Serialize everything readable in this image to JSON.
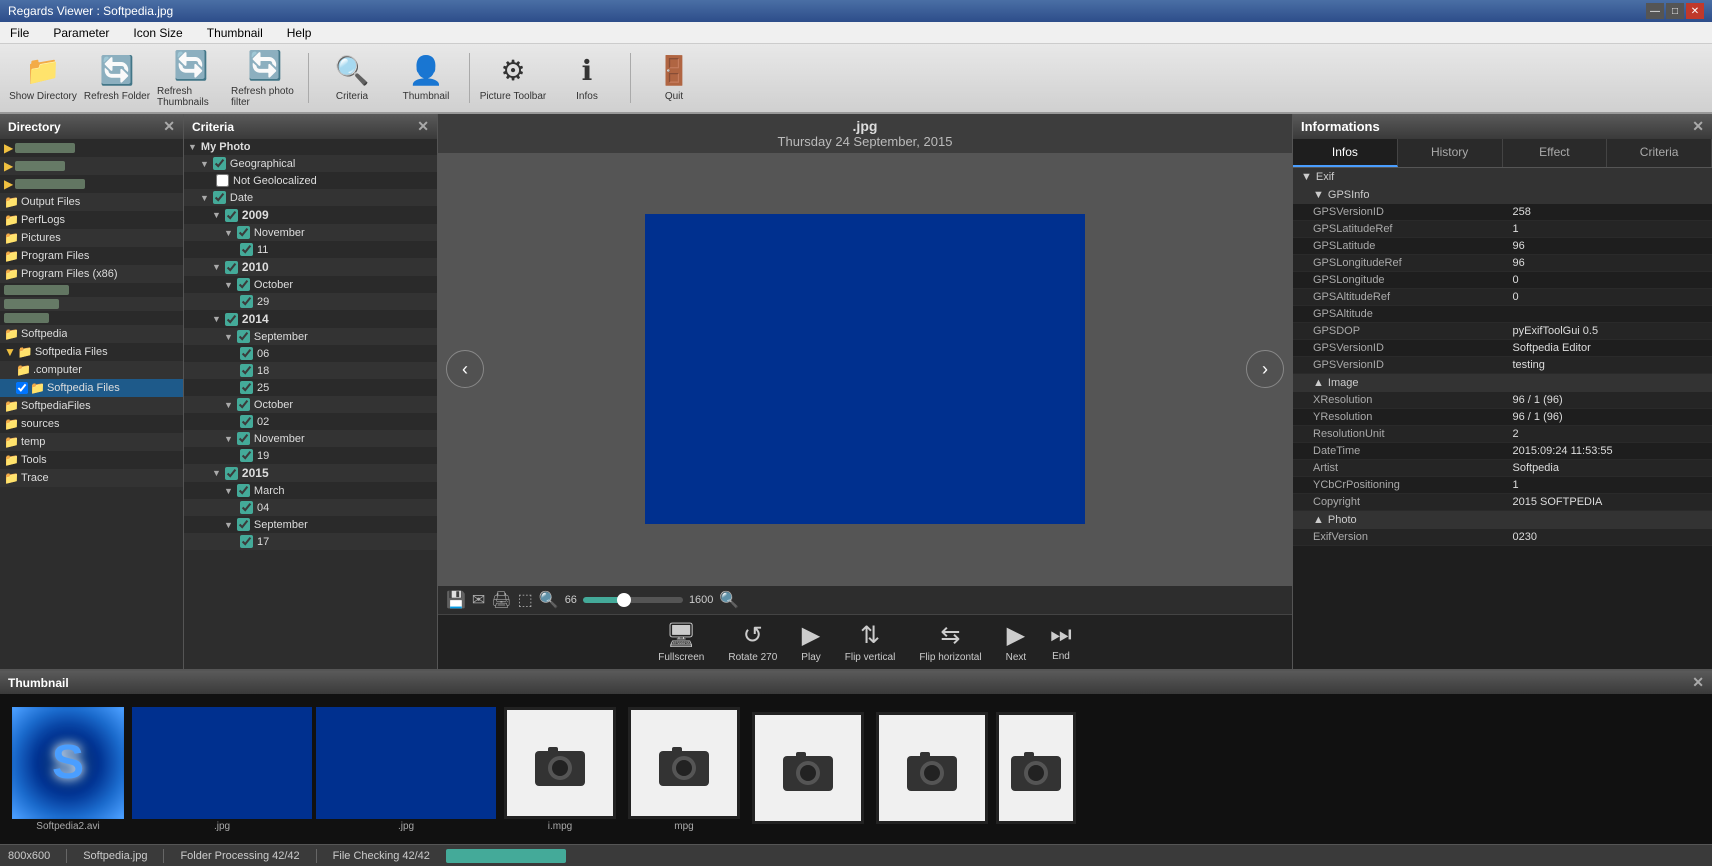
{
  "titlebar": {
    "title": "Regards Viewer : Softpedia.jpg",
    "min_label": "—",
    "max_label": "□",
    "close_label": "✕"
  },
  "menubar": {
    "items": [
      "File",
      "Parameter",
      "Icon Size",
      "Thumbnail",
      "Help"
    ]
  },
  "toolbar": {
    "buttons": [
      {
        "label": "Show Directory",
        "icon": "📁"
      },
      {
        "label": "Refresh Folder",
        "icon": "🔄"
      },
      {
        "label": "Refresh Thumbnails",
        "icon": "🔄"
      },
      {
        "label": "Refresh photo filter",
        "icon": "🔄"
      },
      {
        "label": "Criteria",
        "icon": "🔍"
      },
      {
        "label": "Thumbnail",
        "icon": "👤"
      },
      {
        "label": "Picture Toolbar",
        "icon": "⚙"
      },
      {
        "label": "Infos",
        "icon": "ℹ"
      },
      {
        "label": "Quit",
        "icon": "🚪"
      }
    ]
  },
  "directory": {
    "title": "Directory",
    "items": [
      {
        "label": "...",
        "indent": 0,
        "checked": false
      },
      {
        "label": "...",
        "indent": 0,
        "checked": false
      },
      {
        "label": "...",
        "indent": 0,
        "checked": false
      },
      {
        "label": "Output Files",
        "indent": 0,
        "checked": false
      },
      {
        "label": "PerfLogs",
        "indent": 0,
        "checked": false
      },
      {
        "label": "Pictures",
        "indent": 0,
        "checked": false
      },
      {
        "label": "Program Files",
        "indent": 0,
        "checked": false
      },
      {
        "label": "Program Files (x86)",
        "indent": 0,
        "checked": false
      },
      {
        "label": "...",
        "indent": 0,
        "checked": false
      },
      {
        "label": "...",
        "indent": 0,
        "checked": false
      },
      {
        "label": "...",
        "indent": 0,
        "checked": false
      },
      {
        "label": "Softpedia",
        "indent": 0,
        "checked": false
      },
      {
        "label": "Softpedia Files",
        "indent": 0,
        "checked": false
      },
      {
        "label": ".computer",
        "indent": 1,
        "checked": false
      },
      {
        "label": "Softpedia Files",
        "indent": 1,
        "checked": true
      },
      {
        "label": "SoftpediaFiles",
        "indent": 0,
        "checked": false
      },
      {
        "label": "sources",
        "indent": 0,
        "checked": false
      },
      {
        "label": "temp",
        "indent": 0,
        "checked": false
      },
      {
        "label": "Tools",
        "indent": 0,
        "checked": false
      },
      {
        "label": "Trace",
        "indent": 0,
        "checked": false
      }
    ]
  },
  "criteria": {
    "title": "Criteria",
    "tree": [
      {
        "label": "My Photo",
        "indent": 0,
        "type": "parent",
        "expanded": true
      },
      {
        "label": "Geographical",
        "indent": 1,
        "type": "parent",
        "expanded": true,
        "checked": true
      },
      {
        "label": "Not Geolocalized",
        "indent": 2,
        "type": "leaf",
        "checked": false
      },
      {
        "label": "Date",
        "indent": 1,
        "type": "parent",
        "expanded": true,
        "checked": true
      },
      {
        "label": "2009",
        "indent": 2,
        "type": "year",
        "expanded": true,
        "checked": true
      },
      {
        "label": "November",
        "indent": 3,
        "type": "month",
        "expanded": true,
        "checked": true
      },
      {
        "label": "11",
        "indent": 4,
        "type": "day",
        "checked": true
      },
      {
        "label": "2010",
        "indent": 2,
        "type": "year",
        "expanded": true,
        "checked": true
      },
      {
        "label": "October",
        "indent": 3,
        "type": "month",
        "expanded": true,
        "checked": true
      },
      {
        "label": "29",
        "indent": 4,
        "type": "day",
        "checked": true
      },
      {
        "label": "2014",
        "indent": 2,
        "type": "year",
        "expanded": true,
        "checked": true
      },
      {
        "label": "September",
        "indent": 3,
        "type": "month",
        "expanded": true,
        "checked": true
      },
      {
        "label": "06",
        "indent": 4,
        "type": "day",
        "checked": true
      },
      {
        "label": "18",
        "indent": 4,
        "type": "day",
        "checked": true
      },
      {
        "label": "25",
        "indent": 4,
        "type": "day",
        "checked": true
      },
      {
        "label": "October",
        "indent": 3,
        "type": "month",
        "expanded": true,
        "checked": true
      },
      {
        "label": "02",
        "indent": 4,
        "type": "day",
        "checked": true
      },
      {
        "label": "November",
        "indent": 3,
        "type": "month",
        "expanded": true,
        "checked": true
      },
      {
        "label": "19",
        "indent": 4,
        "type": "day",
        "checked": true
      },
      {
        "label": "2015",
        "indent": 2,
        "type": "year",
        "expanded": true,
        "checked": true
      },
      {
        "label": "March",
        "indent": 3,
        "type": "month",
        "expanded": true,
        "checked": true
      },
      {
        "label": "04",
        "indent": 4,
        "type": "day",
        "checked": true
      },
      {
        "label": "September",
        "indent": 3,
        "type": "month",
        "expanded": true,
        "checked": true
      },
      {
        "label": "17",
        "indent": 4,
        "type": "day",
        "checked": true
      }
    ]
  },
  "viewer": {
    "filename": ".jpg",
    "date": "Thursday 24 September, 2015",
    "zoom_value": "66",
    "zoom_min": "1600",
    "image_bg": "#00308F"
  },
  "viewer_actions": [
    {
      "label": "Fullscreen",
      "icon": "🖥"
    },
    {
      "label": "Rotate 270",
      "icon": "↺"
    },
    {
      "label": "Play",
      "icon": "▶"
    },
    {
      "label": "Flip vertical",
      "icon": "⇅"
    },
    {
      "label": "Flip horizontal",
      "icon": "⇆"
    },
    {
      "label": "Next",
      "icon": "▶"
    },
    {
      "label": "End",
      "icon": "⏭"
    }
  ],
  "info_panel": {
    "title": "Informations",
    "tabs": [
      "Infos",
      "History",
      "Effect",
      "Criteria"
    ],
    "active_tab": "Infos",
    "sections": [
      {
        "name": "Exif",
        "subsections": [
          {
            "name": "GPSInfo",
            "rows": [
              {
                "key": "GPSVersionID",
                "value": "258"
              },
              {
                "key": "GPSLatitudeRef",
                "value": "1"
              },
              {
                "key": "GPSLatitude",
                "value": "96"
              },
              {
                "key": "GPSLongitudeRef",
                "value": "96"
              },
              {
                "key": "GPSLongitude",
                "value": "0"
              },
              {
                "key": "GPSAltitudeRef",
                "value": "0"
              },
              {
                "key": "GPSAltitude",
                "value": ""
              },
              {
                "key": "GPSDOP",
                "value": "pyExifToolGui 0.5"
              },
              {
                "key": "GPSVersionID",
                "value": "Softpedia Editor"
              },
              {
                "key": "GPSVersionID",
                "value": "testing"
              }
            ]
          },
          {
            "name": "Image",
            "rows": [
              {
                "key": "XResolution",
                "value": "96 / 1 (96)"
              },
              {
                "key": "YResolution",
                "value": "96 / 1 (96)"
              },
              {
                "key": "ResolutionUnit",
                "value": "2"
              },
              {
                "key": "DateTime",
                "value": "2015:09:24 11:53:55"
              },
              {
                "key": "Artist",
                "value": "Softpedia"
              },
              {
                "key": "YCbCrPositioning",
                "value": "1"
              },
              {
                "key": "Copyright",
                "value": "2015 SOFTPEDIA"
              }
            ]
          },
          {
            "name": "Photo",
            "rows": [
              {
                "key": "ExifVersion",
                "value": "0230"
              }
            ]
          }
        ]
      }
    ]
  },
  "thumbnail": {
    "title": "Thumbnail",
    "items": [
      {
        "label": "Softpedia2.avi",
        "type": "s-logo"
      },
      {
        "label": ".jpg",
        "type": "blue"
      },
      {
        "label": ".jpg",
        "type": "blue2"
      },
      {
        "label": "i.mpg",
        "type": "camera"
      },
      {
        "label": "mpg",
        "type": "camera"
      },
      {
        "label": "",
        "type": "camera"
      },
      {
        "label": "",
        "type": "camera"
      },
      {
        "label": "",
        "type": "camera"
      }
    ]
  },
  "statusbar": {
    "size": "800x600",
    "filename": "Softpedia.jpg",
    "folder_processing": "Folder Processing 42/42",
    "file_checking": "File Checking 42/42",
    "progress": 100
  }
}
